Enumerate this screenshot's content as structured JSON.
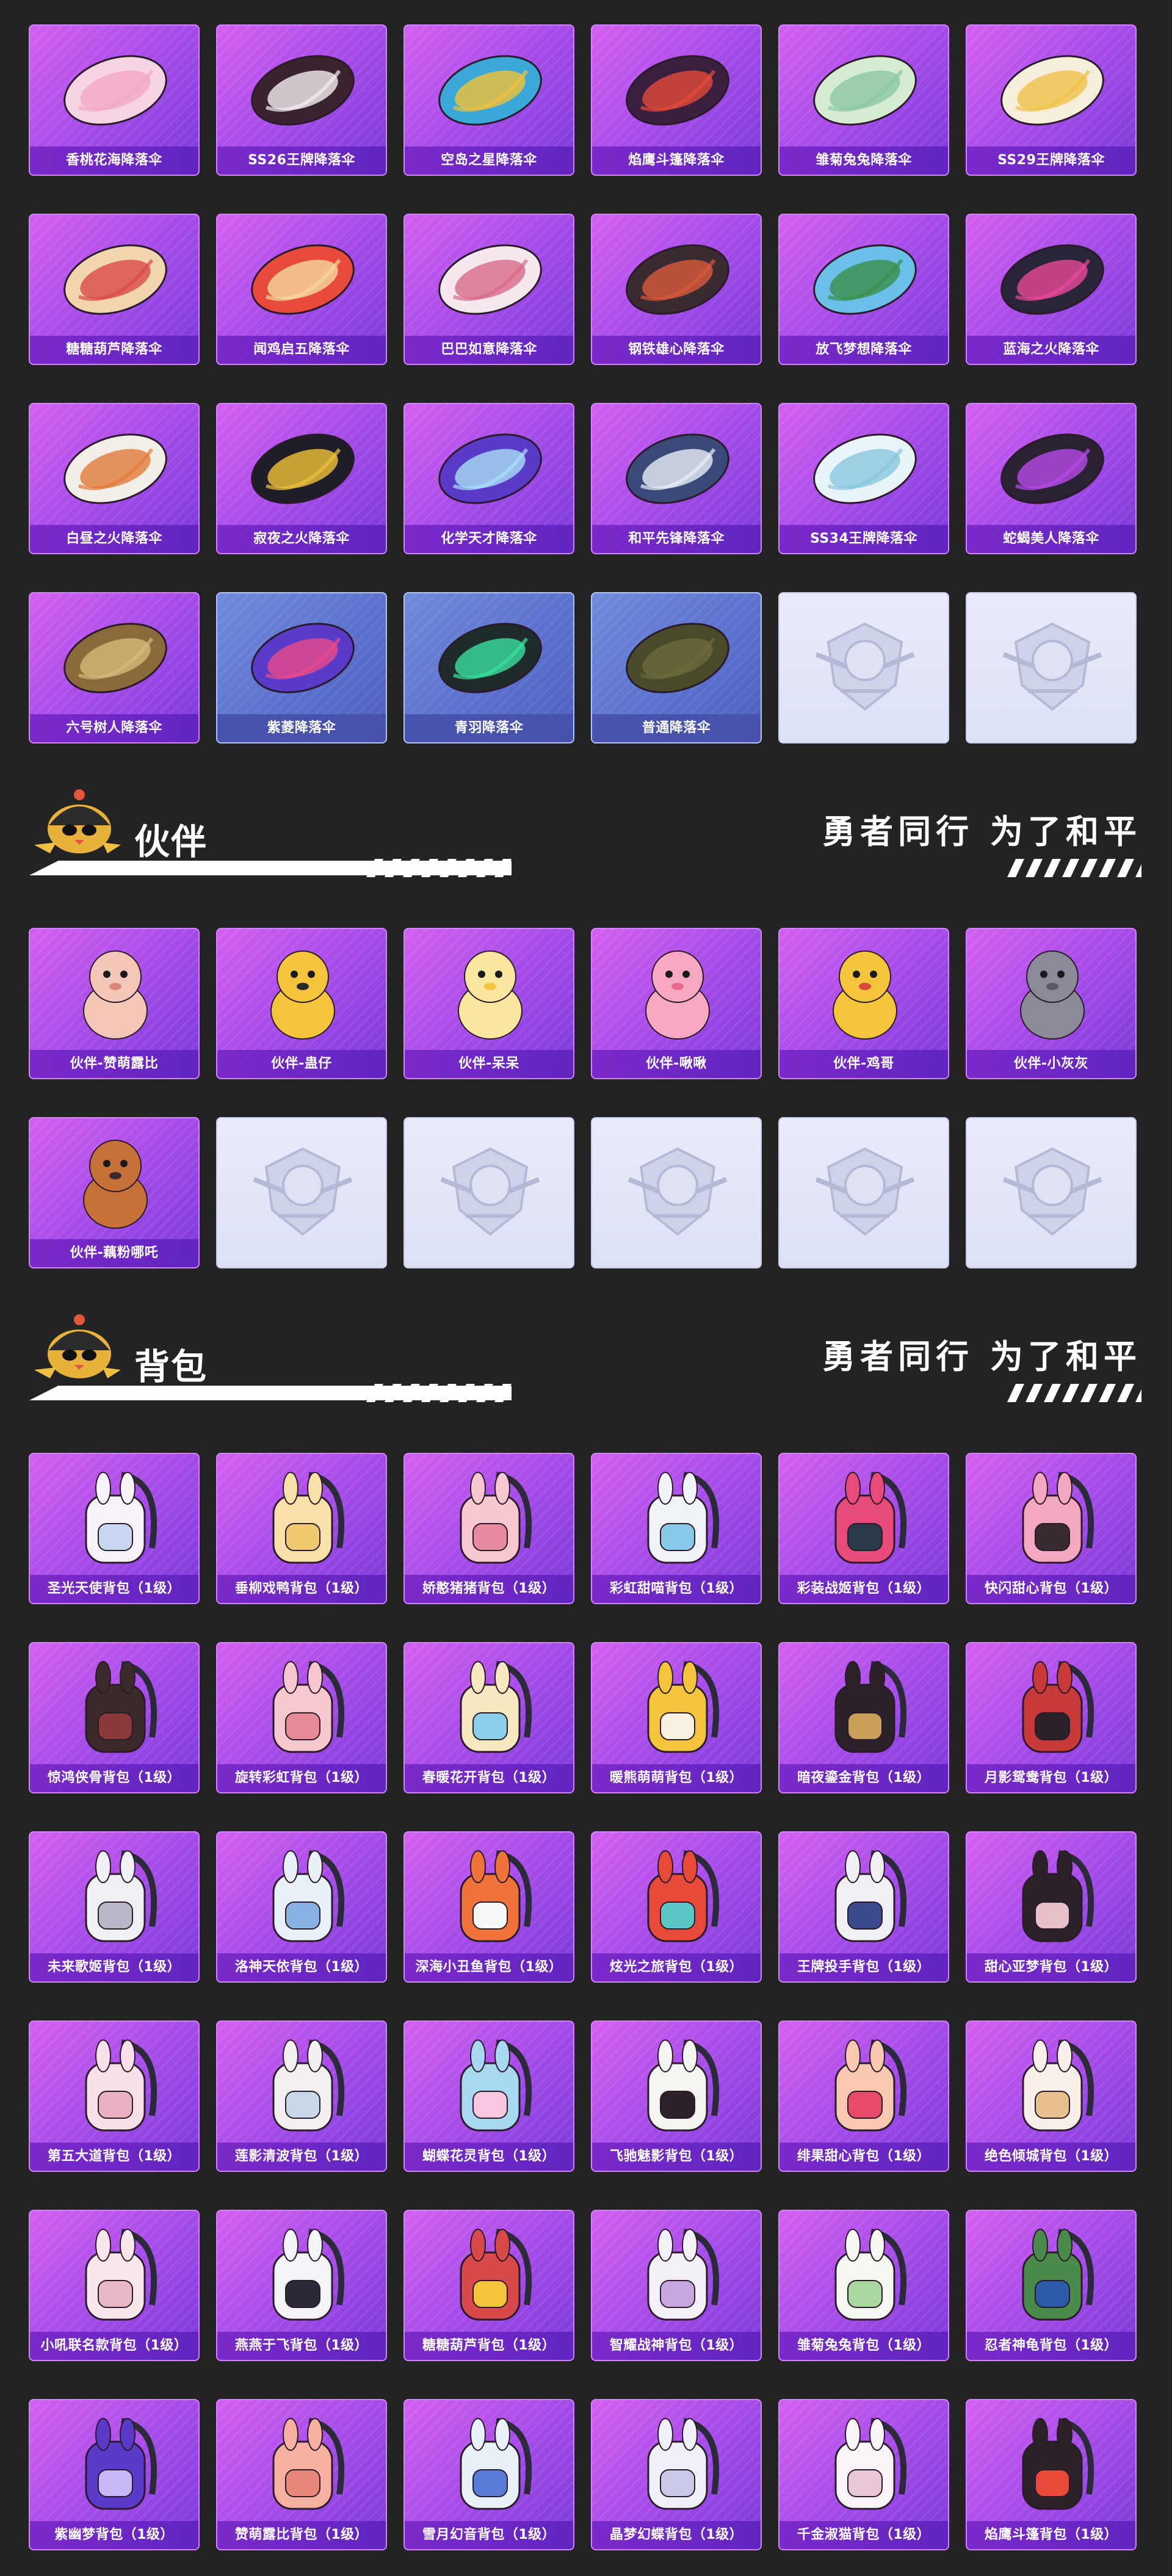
{
  "parachutes": {
    "rows": [
      [
        {
          "label": "香桃花海降落伞",
          "style": "purple",
          "colors": [
            "#f7d4e4",
            "#f1a8c6"
          ]
        },
        {
          "label": "SS26王牌降落伞",
          "style": "purple",
          "colors": [
            "#3a2230",
            "#f4f0f2"
          ]
        },
        {
          "label": "空岛之星降落伞",
          "style": "purple",
          "colors": [
            "#3aa8d8",
            "#f2c23a"
          ]
        },
        {
          "label": "焰鹰斗篷降落伞",
          "style": "purple",
          "colors": [
            "#3a1f3f",
            "#e24a3a"
          ]
        },
        {
          "label": "雏菊兔兔降落伞",
          "style": "purple",
          "colors": [
            "#d6ecd0",
            "#8cc8a0"
          ]
        },
        {
          "label": "SS29王牌降落伞",
          "style": "purple",
          "colors": [
            "#f5eedb",
            "#f0c24a"
          ]
        }
      ],
      [
        {
          "label": "糖糖葫芦降落伞",
          "style": "purple",
          "colors": [
            "#f2d6b0",
            "#d94a4a"
          ]
        },
        {
          "label": "闻鸡启五降落伞",
          "style": "purple",
          "colors": [
            "#e74a3a",
            "#f6d9a0"
          ]
        },
        {
          "label": "巴巴如意降落伞",
          "style": "purple",
          "colors": [
            "#f6e8ee",
            "#d86a88"
          ]
        },
        {
          "label": "钢铁雄心降落伞",
          "style": "purple",
          "colors": [
            "#3a2a32",
            "#d95a3a"
          ]
        },
        {
          "label": "放飞梦想降落伞",
          "style": "purple",
          "colors": [
            "#6ac0e8",
            "#3a8e4a"
          ]
        },
        {
          "label": "蓝海之火降落伞",
          "style": "purple",
          "colors": [
            "#2a2438",
            "#e84a9a"
          ]
        }
      ],
      [
        {
          "label": "白昼之火降落伞",
          "style": "purple",
          "colors": [
            "#f3efe8",
            "#e27a3a"
          ]
        },
        {
          "label": "寂夜之火降落伞",
          "style": "purple",
          "colors": [
            "#1f1e28",
            "#f0c23a"
          ]
        },
        {
          "label": "化学天才降落伞",
          "style": "purple",
          "colors": [
            "#5a3ac8",
            "#a8e0f8"
          ]
        },
        {
          "label": "和平先锋降落伞",
          "style": "purple",
          "colors": [
            "#3a4a78",
            "#e8eef8"
          ]
        },
        {
          "label": "SS34王牌降落伞",
          "style": "purple",
          "colors": [
            "#e8f4f8",
            "#88c8e0"
          ]
        },
        {
          "label": "蛇蝎美人降落伞",
          "style": "purple",
          "colors": [
            "#2a2232",
            "#b84ae8"
          ]
        }
      ],
      [
        {
          "label": "六号树人降落伞",
          "style": "purple",
          "colors": [
            "#8a6a3a",
            "#d8b87a"
          ]
        },
        {
          "label": "紫菱降落伞",
          "style": "blue",
          "colors": [
            "#5a3ac8",
            "#e84a8a"
          ]
        },
        {
          "label": "青羽降落伞",
          "style": "blue",
          "colors": [
            "#1f2a2a",
            "#3ae0a0"
          ]
        },
        {
          "label": "普通降落伞",
          "style": "blue",
          "colors": [
            "#4a4a2a",
            "#6a6a3a"
          ]
        },
        {
          "label": "",
          "style": "placeholder",
          "colors": [
            "#c8cbe0",
            "#e6e8f4"
          ]
        },
        {
          "label": "",
          "style": "placeholder",
          "colors": [
            "#c8cbe0",
            "#e6e8f4"
          ]
        }
      ]
    ]
  },
  "partners": {
    "title": "伙伴",
    "slogan": "勇者同行 为了和平",
    "rows": [
      [
        {
          "label": "伙伴-赞萌露比",
          "style": "purple",
          "colors": [
            "#f3c6b8",
            "#d88a7a"
          ]
        },
        {
          "label": "伙伴-蛊仔",
          "style": "purple",
          "colors": [
            "#f4c43a",
            "#2a2a2a"
          ]
        },
        {
          "label": "伙伴-呆呆",
          "style": "purple",
          "colors": [
            "#fbe6a0",
            "#f4c43a"
          ]
        },
        {
          "label": "伙伴-啾啾",
          "style": "purple",
          "colors": [
            "#f8a8c0",
            "#e86a90"
          ]
        },
        {
          "label": "伙伴-鸡哥",
          "style": "purple",
          "colors": [
            "#f4c43a",
            "#d84a3a"
          ]
        },
        {
          "label": "伙伴-小灰灰",
          "style": "purple",
          "colors": [
            "#8a8a98",
            "#5a5a68"
          ]
        }
      ],
      [
        {
          "label": "伙伴-藕粉哪吒",
          "style": "purple",
          "colors": [
            "#c8703a",
            "#3a2a2a"
          ]
        },
        {
          "label": "",
          "style": "placeholder",
          "colors": [
            "#c8cbe0",
            "#e6e8f4"
          ]
        },
        {
          "label": "",
          "style": "placeholder",
          "colors": [
            "#c8cbe0",
            "#e6e8f4"
          ]
        },
        {
          "label": "",
          "style": "placeholder",
          "colors": [
            "#c8cbe0",
            "#e6e8f4"
          ]
        },
        {
          "label": "",
          "style": "placeholder",
          "colors": [
            "#c8cbe0",
            "#e6e8f4"
          ]
        },
        {
          "label": "",
          "style": "placeholder",
          "colors": [
            "#c8cbe0",
            "#e6e8f4"
          ]
        }
      ]
    ]
  },
  "backpacks": {
    "title": "背包",
    "slogan": "勇者同行 为了和平",
    "rows": [
      [
        {
          "label": "圣光天使背包（1级）",
          "style": "purple",
          "colors": [
            "#f6f2f8",
            "#c8d8f0"
          ]
        },
        {
          "label": "垂柳戏鸭背包（1级）",
          "style": "purple",
          "colors": [
            "#f8e0a8",
            "#f0c870"
          ]
        },
        {
          "label": "娇憨猪猪背包（1级）",
          "style": "purple",
          "colors": [
            "#f8c8d0",
            "#e88aa0"
          ]
        },
        {
          "label": "彩虹甜喵背包（1级）",
          "style": "purple",
          "colors": [
            "#f0f4f8",
            "#88c8e8"
          ]
        },
        {
          "label": "彩装战姬背包（1级）",
          "style": "purple",
          "colors": [
            "#e84a7a",
            "#2a3a4a"
          ]
        },
        {
          "label": "快闪甜心背包（1级）",
          "style": "purple",
          "colors": [
            "#f4a8c0",
            "#3a2a32"
          ]
        }
      ],
      [
        {
          "label": "惊鸿侠骨背包（1级）",
          "style": "purple",
          "colors": [
            "#3a2a2a",
            "#8a3a3a"
          ]
        },
        {
          "label": "旋转彩虹背包（1级）",
          "style": "purple",
          "colors": [
            "#f8c8d0",
            "#e88a9a"
          ]
        },
        {
          "label": "春暖花开背包（1级）",
          "style": "purple",
          "colors": [
            "#f8e8c0",
            "#8ad0e8"
          ]
        },
        {
          "label": "暖熊萌萌背包（1级）",
          "style": "purple",
          "colors": [
            "#f4c43a",
            "#f8f0e0"
          ]
        },
        {
          "label": "暗夜鎏金背包（1级）",
          "style": "purple",
          "colors": [
            "#2a2228",
            "#c8a05a"
          ]
        },
        {
          "label": "月影鸳鸯背包（1级）",
          "style": "purple",
          "colors": [
            "#c83a3a",
            "#2a2228"
          ]
        }
      ],
      [
        {
          "label": "未来歌姬背包（1级）",
          "style": "purple",
          "colors": [
            "#f0f0f4",
            "#b8b8c8"
          ]
        },
        {
          "label": "洛神天依背包（1级）",
          "style": "purple",
          "colors": [
            "#e8f0f8",
            "#88b0e0"
          ]
        },
        {
          "label": "深海小丑鱼背包（1级）",
          "style": "purple",
          "colors": [
            "#f0743a",
            "#f8f8f8"
          ]
        },
        {
          "label": "炫光之旅背包（1级）",
          "style": "purple",
          "colors": [
            "#e84a3a",
            "#5ac8c8"
          ]
        },
        {
          "label": "王牌投手背包（1级）",
          "style": "purple",
          "colors": [
            "#f0f0f4",
            "#3a4a8a"
          ]
        },
        {
          "label": "甜心亚梦背包（1级）",
          "style": "purple",
          "colors": [
            "#2a2228",
            "#e8c0c8"
          ]
        }
      ],
      [
        {
          "label": "第五大道背包（1级）",
          "style": "purple",
          "colors": [
            "#f8e0e8",
            "#e8b0c0"
          ]
        },
        {
          "label": "莲影清波背包（1级）",
          "style": "purple",
          "colors": [
            "#f4f0f0",
            "#c8d8e8"
          ]
        },
        {
          "label": "蝴蝶花灵背包（1级）",
          "style": "purple",
          "colors": [
            "#a8d8f0",
            "#f8c8e0"
          ]
        },
        {
          "label": "飞驰魅影背包（1级）",
          "style": "purple",
          "colors": [
            "#f4f4f0",
            "#2a2228"
          ]
        },
        {
          "label": "绯果甜心背包（1级）",
          "style": "purple",
          "colors": [
            "#f8c8b0",
            "#e84a6a"
          ]
        },
        {
          "label": "绝色倾城背包（1级）",
          "style": "purple",
          "colors": [
            "#f8f0e8",
            "#e8c090"
          ]
        }
      ],
      [
        {
          "label": "小吼联名款背包（1级）",
          "style": "purple",
          "colors": [
            "#f8e8ec",
            "#e8b8c8"
          ]
        },
        {
          "label": "燕燕于飞背包（1级）",
          "style": "purple",
          "colors": [
            "#f4f4f8",
            "#2a2a38"
          ]
        },
        {
          "label": "糖糖葫芦背包（1级）",
          "style": "purple",
          "colors": [
            "#d84a4a",
            "#f4c43a"
          ]
        },
        {
          "label": "智耀战神背包（1级）",
          "style": "purple",
          "colors": [
            "#f4f0f8",
            "#c8a8e0"
          ]
        },
        {
          "label": "雏菊兔兔背包（1级）",
          "style": "purple",
          "colors": [
            "#f4f8f0",
            "#a8d8a0"
          ]
        },
        {
          "label": "忍者神龟背包（1级）",
          "style": "purple",
          "colors": [
            "#4a8a4a",
            "#2a5aa8"
          ]
        }
      ],
      [
        {
          "label": "紫幽梦背包（1级）",
          "style": "purple",
          "colors": [
            "#5a3ac8",
            "#c8b8f8"
          ]
        },
        {
          "label": "赞萌露比背包（1级）",
          "style": "purple",
          "colors": [
            "#f8b0a0",
            "#e8887a"
          ]
        },
        {
          "label": "雪月幻音背包（1级）",
          "style": "purple",
          "colors": [
            "#e8f0f8",
            "#5a7ad8"
          ]
        },
        {
          "label": "晶梦幻蝶背包（1级）",
          "style": "purple",
          "colors": [
            "#f0f0f8",
            "#c8c8e8"
          ]
        },
        {
          "label": "千金淑猫背包（1级）",
          "style": "purple",
          "colors": [
            "#f8f4f8",
            "#e8c8d8"
          ]
        },
        {
          "label": "焰鹰斗篷背包（1级）",
          "style": "purple",
          "colors": [
            "#2a2228",
            "#e84a3a"
          ]
        }
      ]
    ]
  }
}
